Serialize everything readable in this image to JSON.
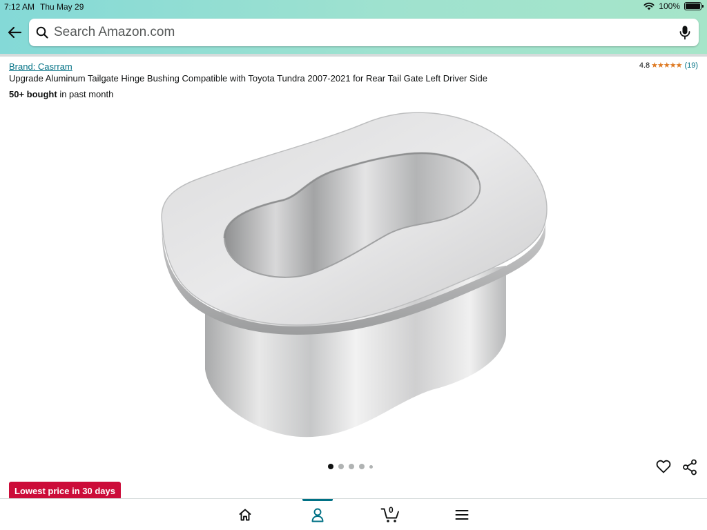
{
  "status_bar": {
    "time": "7:12 AM",
    "date": "Thu May 29",
    "battery": "100%",
    "battery_level": 1.0
  },
  "search": {
    "placeholder": "Search Amazon.com"
  },
  "product": {
    "brand_link": "Brand: Casrram",
    "title": "Upgrade Aluminum Tailgate Hinge Bushing Compatible with Toyota Tundra 2007-2021 for Rear Tail Gate Left Driver Side",
    "bought_count": "50+ bought",
    "bought_suffix": " in past month",
    "rating": "4.8",
    "stars": "★★★★★",
    "star_count": 5,
    "rating_count": "(19)",
    "image_description_icon": "bushing-image"
  },
  "carousel": {
    "total_images": 5,
    "active_index": 0
  },
  "deal_badge": "Lowest price in 30 days",
  "bottom_nav": {
    "items": [
      {
        "name": "home",
        "icon": "home-icon"
      },
      {
        "name": "account",
        "icon": "person-icon",
        "active": true
      },
      {
        "name": "cart",
        "icon": "cart-icon",
        "count": "0"
      },
      {
        "name": "menu",
        "icon": "menu-icon"
      }
    ]
  },
  "colors": {
    "header_gradient_start": "#84d9d7",
    "header_gradient_end": "#a6e5c9",
    "link": "#007185",
    "star": "#de7921",
    "deal_badge": "#cc0c39",
    "nav_active": "#007185"
  }
}
